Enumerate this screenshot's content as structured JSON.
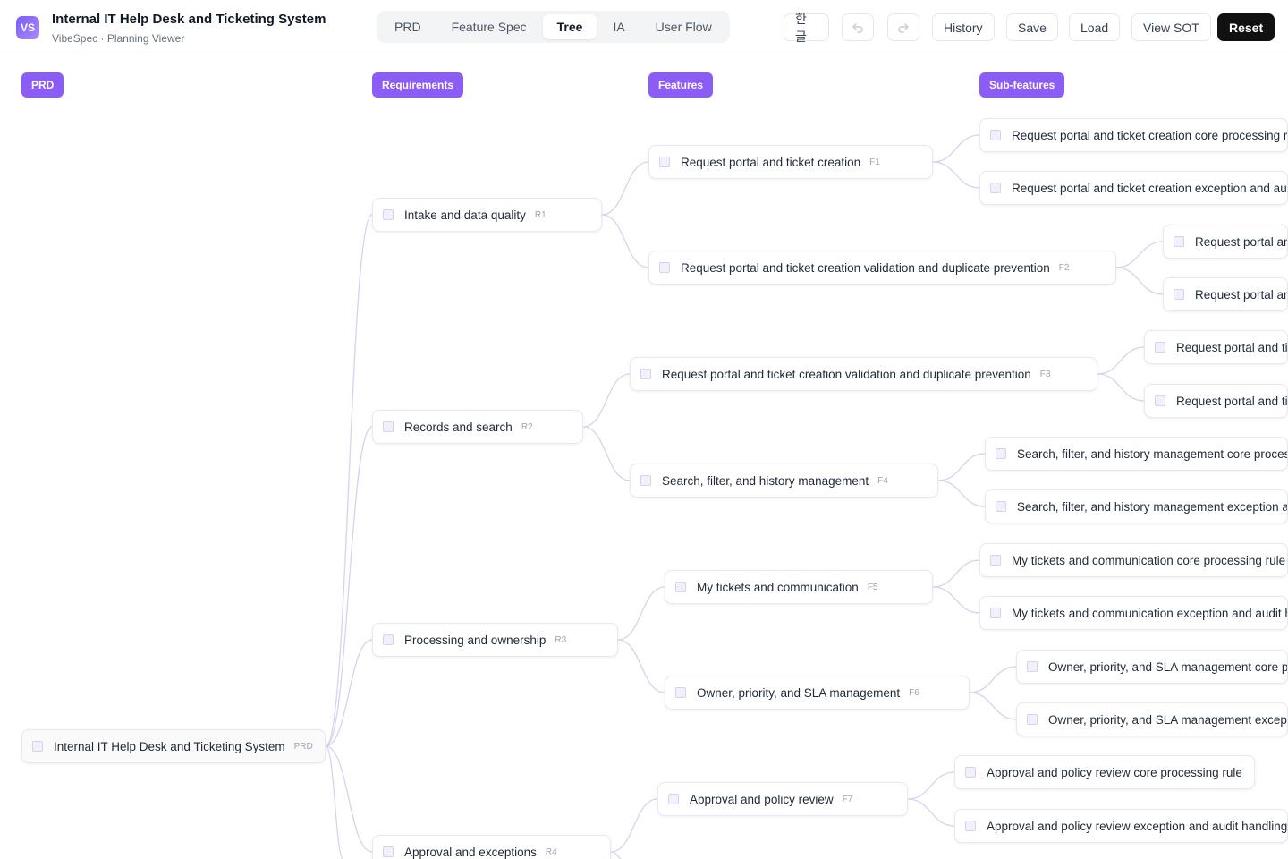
{
  "app": {
    "logo": "VS",
    "title": "Internal IT Help Desk and Ticketing System",
    "subtitle": "VibeSpec · Planning Viewer"
  },
  "tabs": [
    {
      "label": "PRD",
      "active": false
    },
    {
      "label": "Feature Spec",
      "active": false
    },
    {
      "label": "Tree",
      "active": true
    },
    {
      "label": "IA",
      "active": false
    },
    {
      "label": "User Flow",
      "active": false
    }
  ],
  "toolbar": {
    "lang": "한글",
    "undo_icon": "undo-icon",
    "redo_icon": "redo-icon",
    "history": "History",
    "save": "Save",
    "load": "Load",
    "view_sot": "View SOT",
    "reset": "Reset"
  },
  "columns": {
    "prd": "PRD",
    "requirements": "Requirements",
    "features": "Features",
    "subfeatures": "Sub-features"
  },
  "tree": {
    "root": {
      "label": "Internal IT Help Desk and Ticketing System",
      "tag": "PRD"
    },
    "requirements": [
      {
        "label": "Intake and data quality",
        "tag": "R1"
      },
      {
        "label": "Records and search",
        "tag": "R2"
      },
      {
        "label": "Processing and ownership",
        "tag": "R3"
      },
      {
        "label": "Approval and exceptions",
        "tag": "R4"
      }
    ],
    "features": [
      {
        "label": "Request portal and ticket creation",
        "tag": "F1"
      },
      {
        "label": "Request portal and ticket creation validation and duplicate prevention",
        "tag": "F2"
      },
      {
        "label": "Request portal and ticket creation validation and duplicate prevention",
        "tag": "F3"
      },
      {
        "label": "Search, filter, and history management",
        "tag": "F4"
      },
      {
        "label": "My tickets and communication",
        "tag": "F5"
      },
      {
        "label": "Owner, priority, and SLA management",
        "tag": "F6"
      },
      {
        "label": "Approval and policy review",
        "tag": "F7"
      }
    ],
    "subfeatures": [
      {
        "label": "Request portal and ticket creation core processing rule"
      },
      {
        "label": "Request portal and ticket creation exception and audit handling"
      },
      {
        "label": "Request portal and ticket creation validation and duplicate prevention core processing rule"
      },
      {
        "label": "Request portal and ticket creation validation and duplicate prevention exception and audit handling"
      },
      {
        "label": "Request portal and ticket creation validation and duplicate prevention core processing rule"
      },
      {
        "label": "Request portal and ticket creation validation and duplicate prevention exception and audit handling"
      },
      {
        "label": "Search, filter, and history management core processing rule"
      },
      {
        "label": "Search, filter, and history management exception and audit handling"
      },
      {
        "label": "My tickets and communication core processing rule"
      },
      {
        "label": "My tickets and communication exception and audit handling"
      },
      {
        "label": "Owner, priority, and SLA management core processing rule"
      },
      {
        "label": "Owner, priority, and SLA management exception and audit handling"
      },
      {
        "label": "Approval and policy review core processing rule"
      },
      {
        "label": "Approval and policy review exception and audit handling"
      }
    ]
  }
}
